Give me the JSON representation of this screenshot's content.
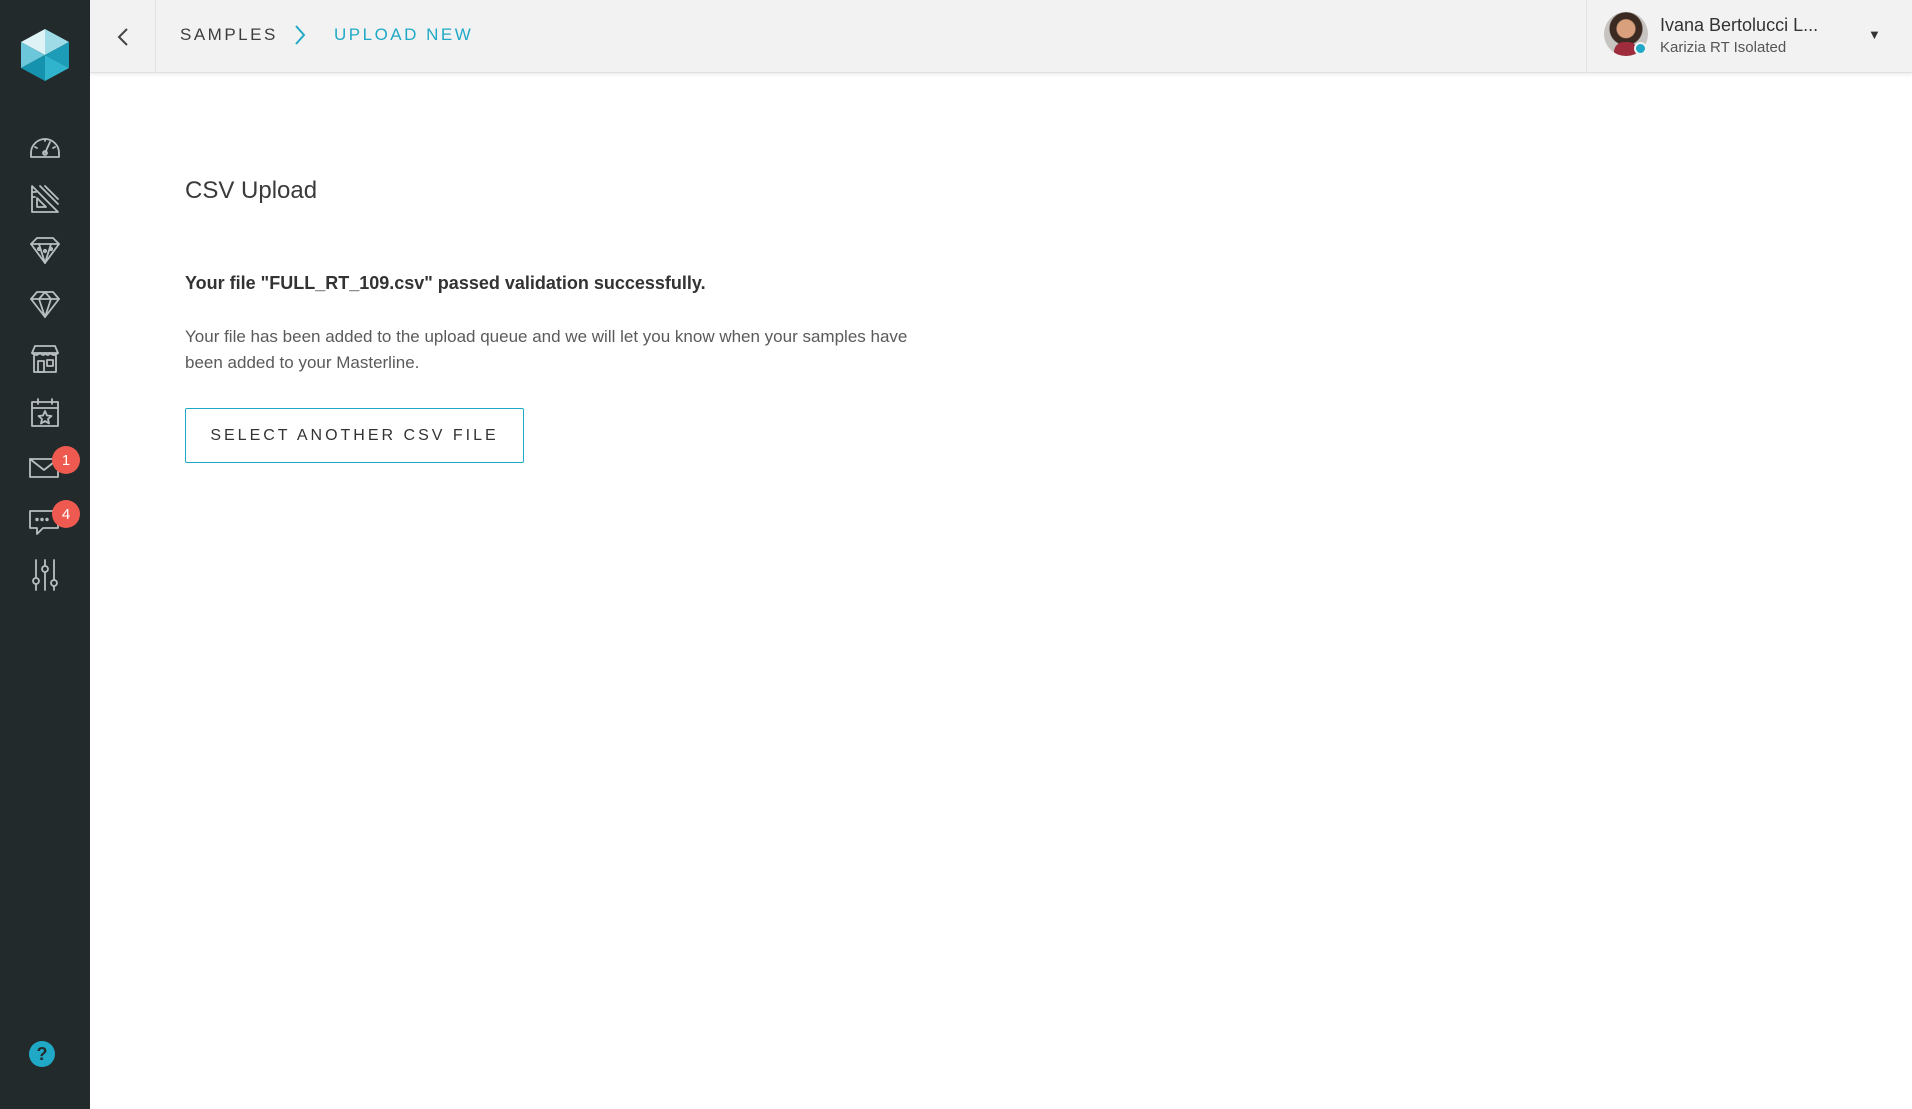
{
  "app": {
    "accent_color": "#20a9c6",
    "sidebar_color": "#222a2b",
    "badge_color": "#ef5a50"
  },
  "sidebar": {
    "logo": "hexagon-cube-logo",
    "items": [
      {
        "icon": "speedometer-icon",
        "badge": null
      },
      {
        "icon": "ruler-triangle-icon",
        "badge": null
      },
      {
        "icon": "diamond-network-icon",
        "badge": null
      },
      {
        "icon": "diamond-icon",
        "badge": null
      },
      {
        "icon": "store-icon",
        "badge": null
      },
      {
        "icon": "calendar-star-icon",
        "badge": null
      },
      {
        "icon": "mail-icon",
        "badge": "1"
      },
      {
        "icon": "chat-icon",
        "badge": "4"
      },
      {
        "icon": "sliders-icon",
        "badge": null
      }
    ],
    "help_label": "?"
  },
  "header": {
    "breadcrumb": [
      {
        "label": "SAMPLES"
      },
      {
        "label": "UPLOAD NEW"
      }
    ],
    "user": {
      "name": "Ivana Bertolucci L...",
      "subtitle": "Karizia RT Isolated",
      "status": "online"
    }
  },
  "main": {
    "title": "CSV Upload",
    "success_message": "Your file \"FULL_RT_109.csv\" passed validation successfully.",
    "info_message": "Your file has been added to the upload queue and we will let you know when your samples have been added to your Masterline.",
    "select_button_label": "SELECT ANOTHER CSV FILE"
  }
}
